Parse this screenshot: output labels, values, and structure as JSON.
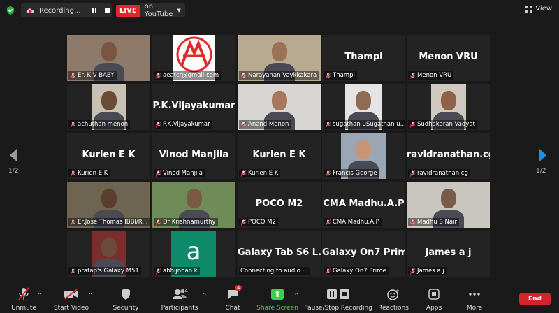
{
  "top": {
    "recording_label": "Recording...",
    "live_badge": "LIVE",
    "live_target": "on YouTube",
    "view_label": "View"
  },
  "pagination": {
    "left": "1/2",
    "right": "1/2"
  },
  "tiles": [
    {
      "label": "Er. K.V BABY",
      "big": ""
    },
    {
      "label": "aeatcr@gmail.com",
      "big": ""
    },
    {
      "label": "Narayanan Vaykkakara",
      "big": ""
    },
    {
      "label": "Thampi",
      "big": "Thampi"
    },
    {
      "label": "Menon VRU",
      "big": "Menon VRU"
    },
    {
      "label": "achuthan menon",
      "big": ""
    },
    {
      "label": "P.K.Vijayakumar",
      "big": "P.K.Vijayakumar"
    },
    {
      "label": "Anand Menon",
      "big": ""
    },
    {
      "label": "sugathan uSugathan u...",
      "big": ""
    },
    {
      "label": "Sudhakaran Vadyat",
      "big": ""
    },
    {
      "label": "Kurien E K",
      "big": "Kurien E K"
    },
    {
      "label": "Vinod Manjila",
      "big": "Vinod Manjila"
    },
    {
      "label": "Kurien E K",
      "big": "Kurien E K"
    },
    {
      "label": "Francis George",
      "big": ""
    },
    {
      "label": "ravidranathan.cg",
      "big": "ravidranathan.cg"
    },
    {
      "label": "Er.José Thomas IBBI/R...",
      "big": ""
    },
    {
      "label": "Dr Krishnamurthy",
      "big": ""
    },
    {
      "label": "POCO M2",
      "big": "POCO M2"
    },
    {
      "label": "CMA Madhu.A.P",
      "big": "CMA Madhu.A.P"
    },
    {
      "label": "Madhu S Nair",
      "big": ""
    },
    {
      "label": "pratap's Galaxy M51",
      "big": ""
    },
    {
      "label": "abhijnhan k",
      "big": ""
    },
    {
      "label": "Connecting to audio ···",
      "big": "Galaxy Tab S6 L..."
    },
    {
      "label": "Galaxy On7 Prime",
      "big": "Galaxy On7 Prime"
    },
    {
      "label": "James a j",
      "big": "James a j"
    }
  ],
  "avatar_letter": "a",
  "toolbar": {
    "unmute": "Unmute",
    "start_video": "Start Video",
    "security": "Security",
    "participants": "Participants",
    "participants_count": "44",
    "chat": "Chat",
    "chat_badge": "4",
    "share_screen": "Share Screen",
    "pause_stop": "Pause/Stop Recording",
    "reactions": "Reactions",
    "apps": "Apps",
    "more": "More",
    "end": "End"
  },
  "colors": {
    "live": "#e0262c",
    "share": "#3ccf4e",
    "active_border": "#d8e04a",
    "end": "#d4232a"
  }
}
